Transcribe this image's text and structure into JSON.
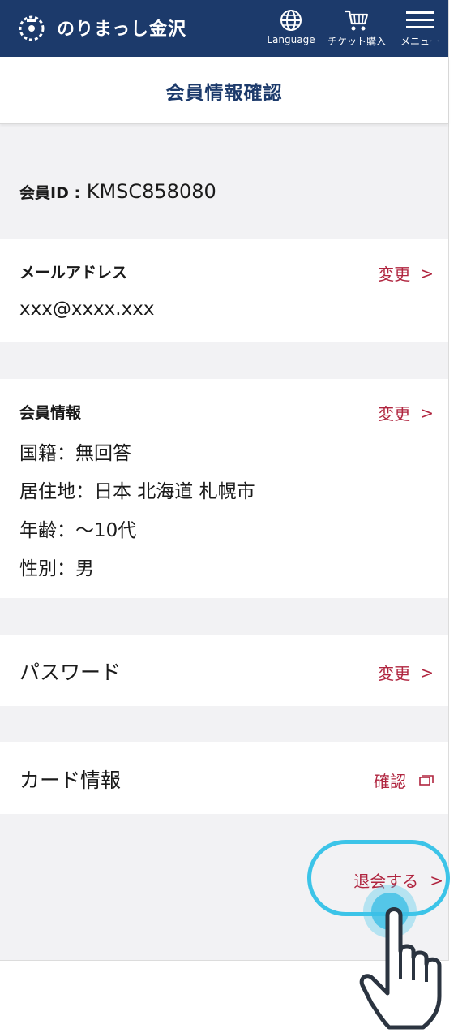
{
  "header": {
    "brand": "のりまっし金沢",
    "language_label": "Language",
    "ticket_label": "チケット購入",
    "menu_label": "メニュー"
  },
  "page": {
    "title": "会員情報確認"
  },
  "member_id": {
    "label": "会員ID :",
    "value": "KMSC858080"
  },
  "email": {
    "label": "メールアドレス",
    "value": "xxx@xxxx.xxx",
    "action": "変更"
  },
  "member_info": {
    "label": "会員情報",
    "action": "変更",
    "nationality": "国籍：無回答",
    "residence": "居住地：日本 北海道 札幌市",
    "age": "年齢：～10代",
    "gender": "性別：男"
  },
  "password": {
    "label": "パスワード",
    "action": "変更"
  },
  "card": {
    "label": "カード情報",
    "action": "確認"
  },
  "withdraw": {
    "label": "退会する"
  },
  "colors": {
    "header_bg": "#1c3a6b",
    "action_red": "#b0253f",
    "highlight": "#3cc4e8"
  }
}
